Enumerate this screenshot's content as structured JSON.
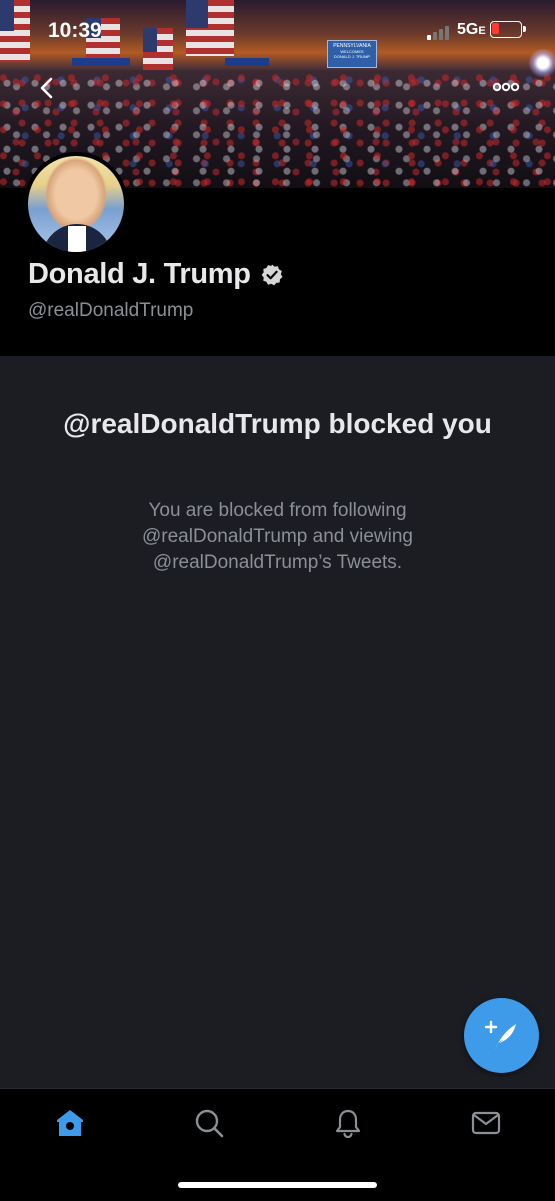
{
  "status_bar": {
    "time": "10:39",
    "network": "5G",
    "network_suffix": "E",
    "signal_bars_active": 1,
    "battery_level_percent": 20,
    "battery_color": "#ff3b30"
  },
  "banner": {
    "sign_text_1": "PENNSYLVANIA",
    "sign_text_2": "WELCOMES",
    "sign_text_3": "DONALD J. TRUMP",
    "icons": {
      "back": "chevron-left-icon",
      "more": "more-horizontal-icon"
    }
  },
  "profile": {
    "name": "Donald J. Trump",
    "handle": "@realDonaldTrump",
    "verified": true
  },
  "blocked": {
    "title": "@realDonaldTrump blocked you",
    "description": "You are blocked from following @realDonaldTrump and viewing @realDonaldTrump’s Tweets."
  },
  "fab": {
    "icon": "compose-tweet-icon",
    "color": "#3d9bea"
  },
  "tabbar": {
    "tabs": [
      {
        "icon": "home-icon",
        "active": true
      },
      {
        "icon": "search-icon",
        "active": false
      },
      {
        "icon": "bell-icon",
        "active": false
      },
      {
        "icon": "mail-icon",
        "active": false
      }
    ],
    "active_color": "#3d9bea",
    "inactive_color": "#8b8f96"
  },
  "colors": {
    "background": "#1c1d22",
    "header_background": "#000000",
    "primary_text": "#e8e8ea",
    "secondary_text": "#8b8f96"
  }
}
